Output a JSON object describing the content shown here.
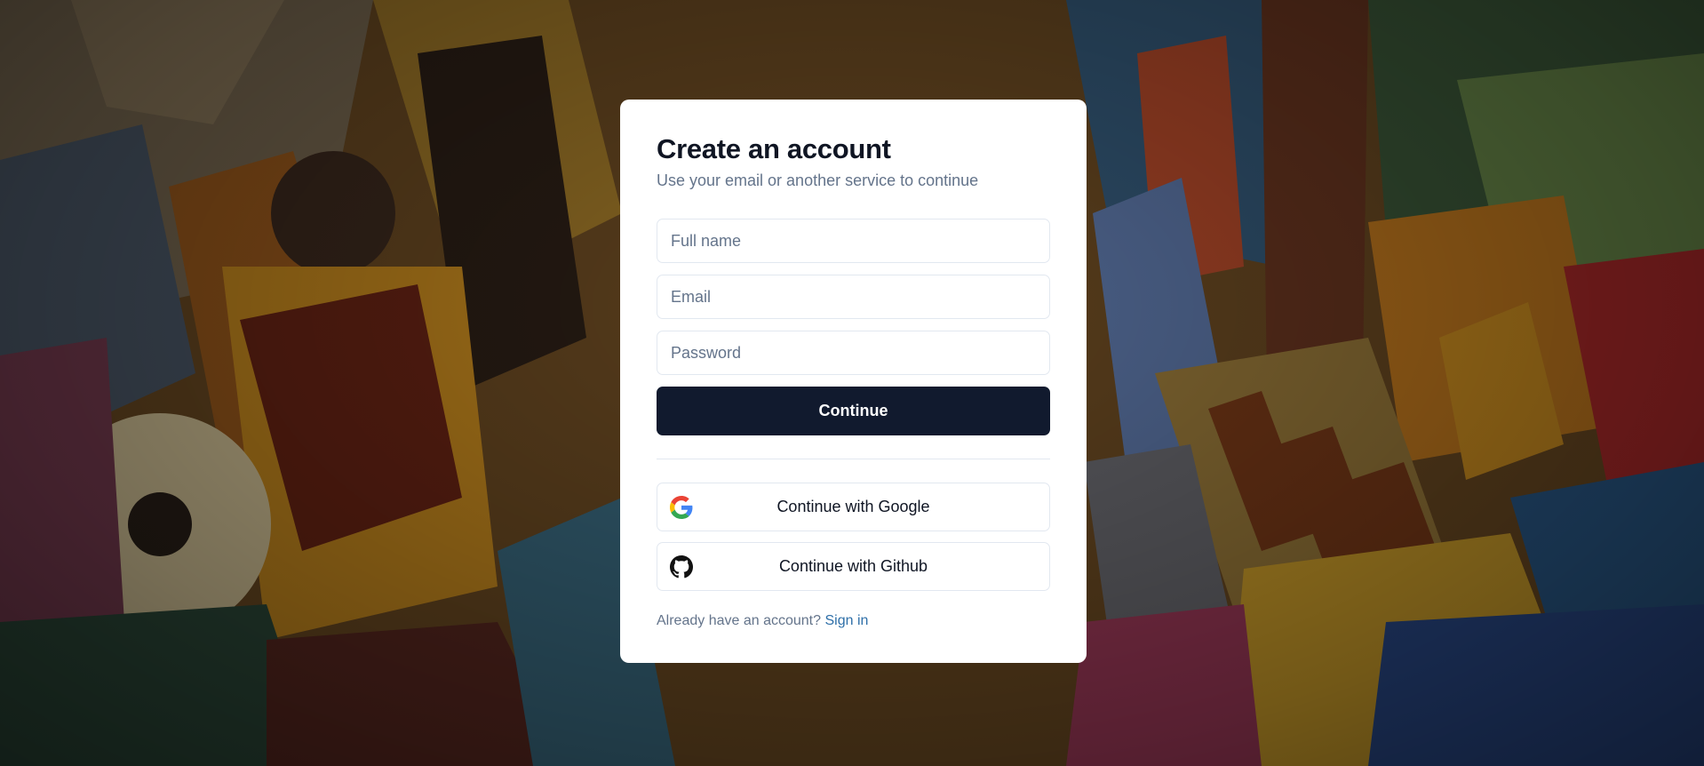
{
  "signup": {
    "title": "Create an account",
    "subtitle": "Use your email or another service to continue",
    "fields": {
      "full_name_placeholder": "Full name",
      "email_placeholder": "Email",
      "password_placeholder": "Password"
    },
    "continue_label": "Continue",
    "oauth": {
      "google_label": "Continue with Google",
      "google_icon": "google-icon",
      "github_label": "Continue with Github",
      "github_icon": "github-icon"
    },
    "footer": {
      "prompt": "Already have an account?",
      "sign_in_label": "Sign in"
    }
  },
  "colors": {
    "primary_button": "#111a2e",
    "link": "#2e6fa8",
    "muted_text": "#64748b",
    "border": "#e2e8f0"
  }
}
